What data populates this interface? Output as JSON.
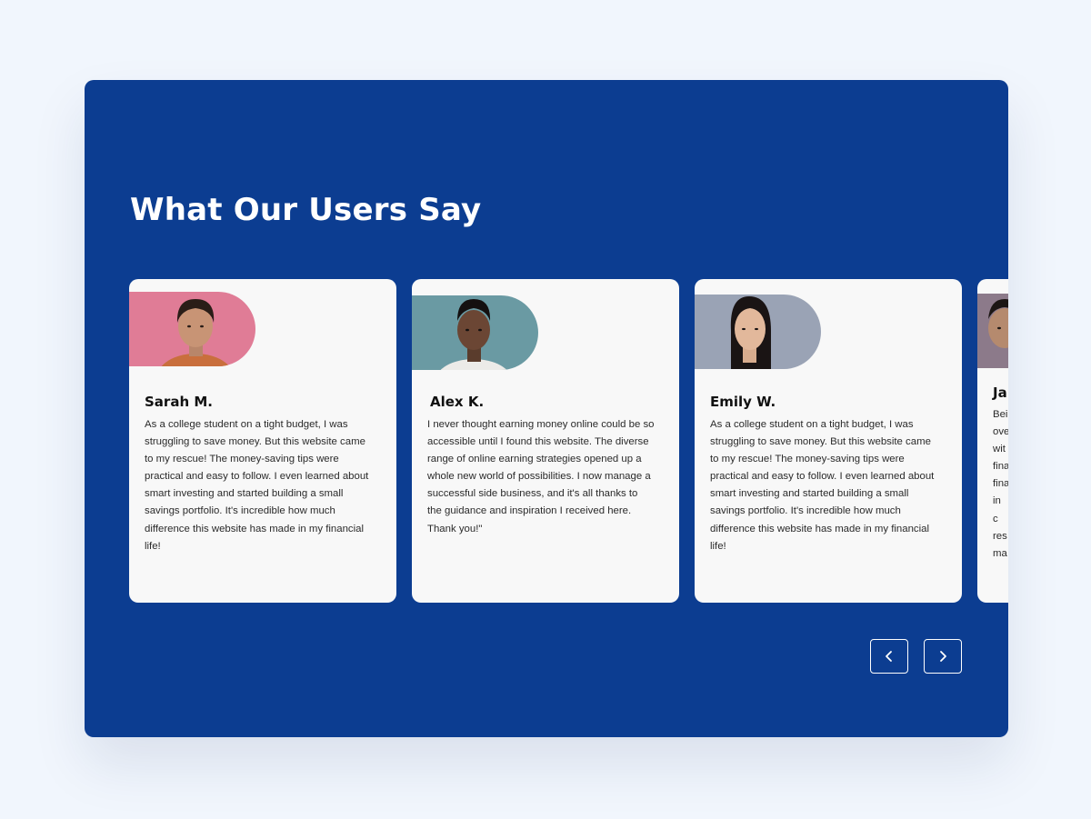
{
  "section": {
    "title": "What Our Users Say"
  },
  "testimonials": [
    {
      "name": "Sarah M.",
      "quote": "As a college student on a tight budget, I was struggling to save money. But this website came to my rescue! The money-saving tips were practical and easy to follow. I even learned about smart investing and started building a small savings portfolio. It's incredible how much difference this website has made in my financial life!"
    },
    {
      "name": "Alex K.",
      "quote": "I never thought earning money online could be so accessible until I found this website. The diverse range of online earning strategies opened up a whole new world of possibilities. I now manage a successful side business, and it's all thanks to the guidance and inspiration I received here. Thank you!\""
    },
    {
      "name": "Emily W.",
      "quote": "As a college student on a tight budget, I was struggling to save money. But this website came to my rescue! The money-saving tips were practical and easy to follow. I even learned about smart investing and started building a small savings portfolio. It's incredible how much difference this website has made in my financial life!"
    },
    {
      "name": "Ja",
      "quote": "Bei ove wit fina fina in c res ma"
    }
  ],
  "navigation": {
    "prev_icon": "chevron-left-icon",
    "next_icon": "chevron-right-icon"
  },
  "colors": {
    "page_background": "#f1f6fd",
    "panel_background": "#0c3d91",
    "card_background": "#f8f8f8",
    "photo_backgrounds": [
      "#e07c96",
      "#6a9aa3",
      "#9aa3b5",
      "#8c7a8a"
    ]
  }
}
